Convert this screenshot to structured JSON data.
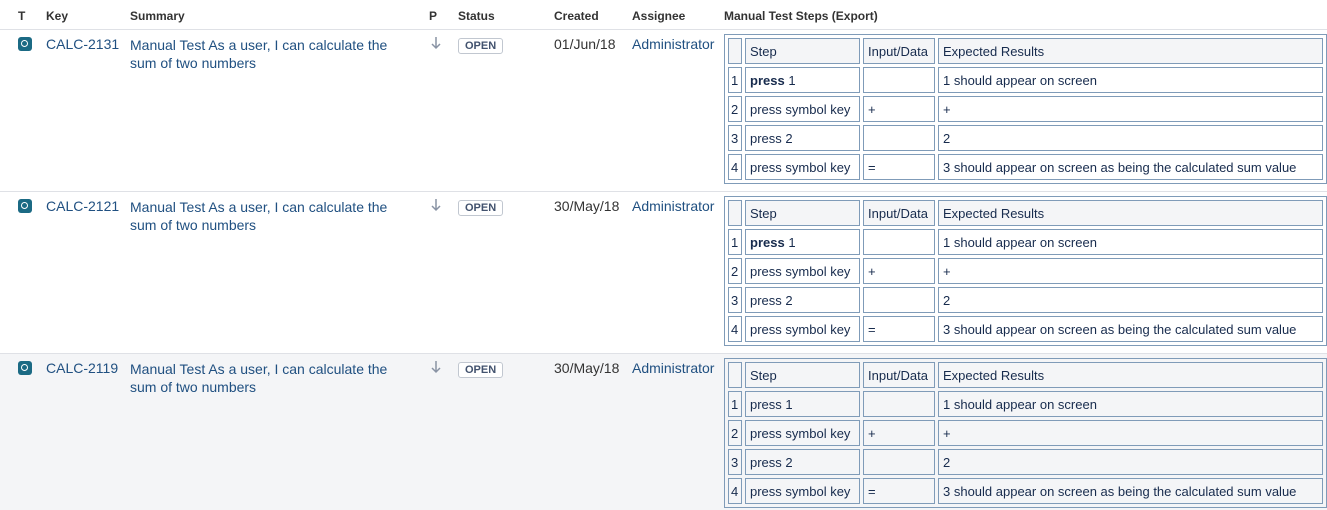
{
  "columns": {
    "type": "T",
    "key": "Key",
    "summary": "Summary",
    "priority": "P",
    "status": "Status",
    "created": "Created",
    "assignee": "Assignee",
    "steps": "Manual Test Steps (Export)"
  },
  "step_headers": {
    "step": "Step",
    "input": "Input/Data",
    "expected": "Expected Results"
  },
  "colors": {
    "link": "#205081",
    "type_icon": "#1b6a84",
    "row_highlight": "#f4f5f7"
  },
  "issues": [
    {
      "type_icon": "test-icon",
      "key": "CALC-2131",
      "summary": "Manual Test As a user, I can calculate the sum of two numbers",
      "priority_icon": "priority-low-arrow-icon",
      "status": "OPEN",
      "created": "01/Jun/18",
      "assignee": "Administrator",
      "steps": [
        {
          "num": "1",
          "step_bold": "press",
          "step_rest": " 1",
          "input": "",
          "expected": "1 should appear on screen"
        },
        {
          "num": "2",
          "step_bold": "",
          "step_rest": "press symbol key",
          "input": "+",
          "expected": "+"
        },
        {
          "num": "3",
          "step_bold": "",
          "step_rest": "press 2",
          "input": "",
          "expected": "2"
        },
        {
          "num": "4",
          "step_bold": "",
          "step_rest": "press symbol key",
          "input": "=",
          "expected": "3 should appear on screen as being the calculated sum value"
        }
      ]
    },
    {
      "type_icon": "test-icon",
      "key": "CALC-2121",
      "summary": "Manual Test As a user, I can calculate the sum of two numbers",
      "priority_icon": "priority-low-arrow-icon",
      "status": "OPEN",
      "created": "30/May/18",
      "assignee": "Administrator",
      "steps": [
        {
          "num": "1",
          "step_bold": "press",
          "step_rest": " 1",
          "input": "",
          "expected": "1 should appear on screen"
        },
        {
          "num": "2",
          "step_bold": "",
          "step_rest": "press symbol key",
          "input": "+",
          "expected": "+"
        },
        {
          "num": "3",
          "step_bold": "",
          "step_rest": "press 2",
          "input": "",
          "expected": "2"
        },
        {
          "num": "4",
          "step_bold": "",
          "step_rest": "press symbol key",
          "input": "=",
          "expected": "3 should appear on screen as being the calculated sum value"
        }
      ]
    },
    {
      "type_icon": "test-icon",
      "key": "CALC-2119",
      "summary": "Manual Test As a user, I can calculate the sum of two numbers",
      "priority_icon": "priority-low-arrow-icon",
      "status": "OPEN",
      "created": "30/May/18",
      "assignee": "Administrator",
      "steps": [
        {
          "num": "1",
          "step_bold": "",
          "step_rest": "press 1",
          "input": "",
          "expected": "1 should appear on screen"
        },
        {
          "num": "2",
          "step_bold": "",
          "step_rest": "press symbol key",
          "input": "+",
          "expected": "+"
        },
        {
          "num": "3",
          "step_bold": "",
          "step_rest": "press 2",
          "input": "",
          "expected": "2"
        },
        {
          "num": "4",
          "step_bold": "",
          "step_rest": "press symbol key",
          "input": "=",
          "expected": "3 should appear on screen as being the calculated sum value"
        }
      ]
    }
  ]
}
